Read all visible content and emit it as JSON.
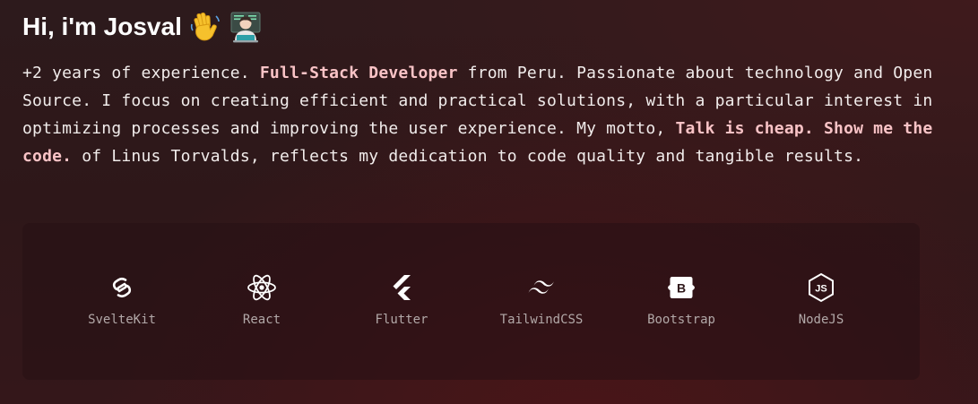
{
  "header": {
    "greeting": "Hi, i'm Josval",
    "emojis": [
      "waving-hand-icon",
      "technologist-icon"
    ]
  },
  "bio": {
    "intro": "+2 years of experience. ",
    "role": "Full-Stack Developer",
    "after_role": " from Peru. Passionate about technology and Open Source. I focus on creating efficient and practical solutions, with a particular interest in optimizing processes and improving the user experience. My motto, ",
    "motto": "Talk is cheap. Show me the code.",
    "after_motto": " of Linus Torvalds, reflects my dedication to code quality and tangible results."
  },
  "stack": {
    "items": [
      {
        "label": "SvelteKit",
        "icon": "svelte-icon"
      },
      {
        "label": "React",
        "icon": "react-icon"
      },
      {
        "label": "Flutter",
        "icon": "flutter-icon"
      },
      {
        "label": "TailwindCSS",
        "icon": "tailwindcss-icon"
      },
      {
        "label": "Bootstrap",
        "icon": "bootstrap-icon"
      },
      {
        "label": "NodeJS",
        "icon": "nodejs-icon"
      }
    ]
  },
  "colors": {
    "highlight": "#f9c3c6",
    "text": "#f1eceb",
    "muted_label": "#b2a8a8"
  }
}
